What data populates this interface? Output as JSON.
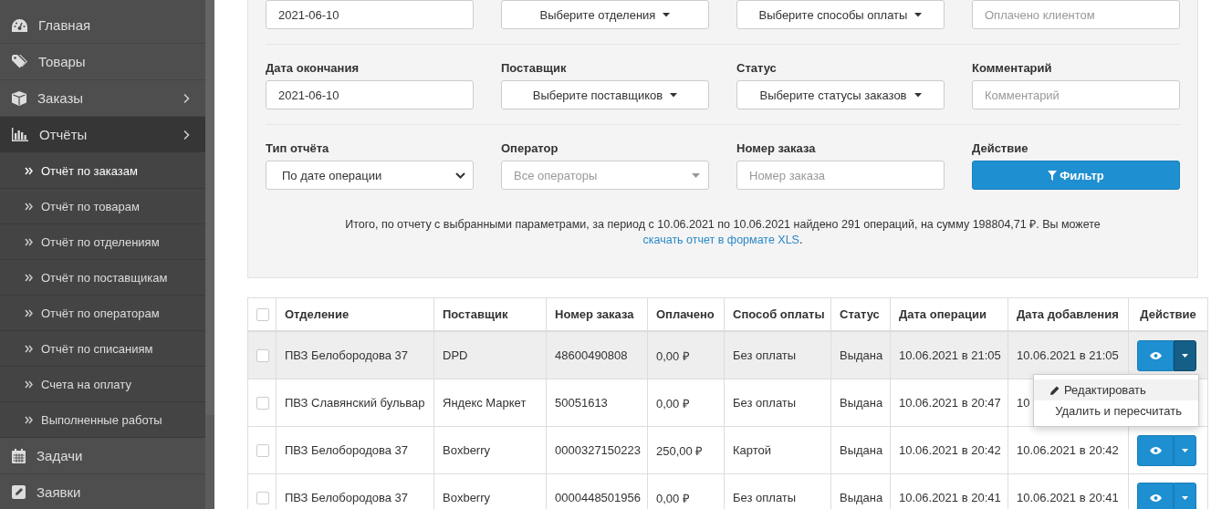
{
  "sidebar": {
    "items": [
      {
        "label": "Главная",
        "selected": false
      },
      {
        "label": "Товары",
        "selected": false
      },
      {
        "label": "Заказы",
        "selected": false,
        "expandable": true
      },
      {
        "label": "Отчёты",
        "selected": true,
        "expandable": true,
        "expanded": true,
        "children": [
          {
            "label": "Отчёт по заказам",
            "selected": true
          },
          {
            "label": "Отчёт по товарам",
            "selected": false
          },
          {
            "label": "Отчёт по отделениям",
            "selected": false
          },
          {
            "label": "Отчёт по поставщикам",
            "selected": false
          },
          {
            "label": "Отчёт по операторам",
            "selected": false
          },
          {
            "label": "Отчёт по списаниям",
            "selected": false
          },
          {
            "label": "Счета на оплату",
            "selected": false
          },
          {
            "label": "Выполненные работы",
            "selected": false
          }
        ]
      },
      {
        "label": "Задачи",
        "selected": false
      },
      {
        "label": "Заявки",
        "selected": false
      }
    ]
  },
  "filters": {
    "rows": [
      [
        {
          "kind": "input",
          "value": "2021-06-10"
        },
        {
          "kind": "dropdown",
          "text": "Выберите отделения"
        },
        {
          "kind": "dropdown",
          "text": "Выберите способы оплаты"
        },
        {
          "kind": "input",
          "placeholder": "Оплачено клиентом"
        }
      ],
      [
        {
          "label": "Дата окончания",
          "kind": "input",
          "value": "2021-06-10"
        },
        {
          "label": "Поставщик",
          "kind": "dropdown",
          "text": "Выберите поставщиков"
        },
        {
          "label": "Статус",
          "kind": "dropdown",
          "text": "Выберите статусы заказов"
        },
        {
          "label": "Комментарий",
          "kind": "input",
          "placeholder": "Комментарий"
        }
      ],
      [
        {
          "label": "Тип отчёта",
          "kind": "select",
          "text": "По дате операции"
        },
        {
          "label": "Оператор",
          "kind": "combo",
          "placeholder": "Все операторы"
        },
        {
          "label": "Номер заказа",
          "kind": "input",
          "placeholder": "Номер заказа"
        },
        {
          "label": "Действие",
          "kind": "button",
          "text": "Фильтр"
        }
      ]
    ],
    "summary": "Итого, по отчету с выбранными параметрами, за период с 10.06.2021 по 10.06.2021 найдено 291 операций, на сумму 198804,71 ₽. Вы можете ",
    "summary_link": "скачать отчет в формате XLS",
    "summary_end": "."
  },
  "table": {
    "all_checked": false,
    "columns": [
      "Отделение",
      "Поставщик",
      "Номер заказа",
      "Оплачено",
      "Способ оплаты",
      "Статус",
      "Дата операции",
      "Дата добавления",
      "Действие"
    ],
    "rows": [
      {
        "cells": [
          "ПВЗ Белобородова 37",
          "DPD",
          "48600490808",
          "0,00 ₽",
          "Без оплаты",
          "Выдана",
          "10.06.2021 в 21:05",
          "10.06.2021 в 21:05"
        ],
        "checked": false,
        "highlighted": true,
        "actions": true,
        "menu_open": true
      },
      {
        "cells": [
          "ПВЗ Славянский бульвар",
          "Яндекс Маркет",
          "50051613",
          "0,00 ₽",
          "Без оплаты",
          "Выдана",
          "10.06.2021 в 20:47",
          "10"
        ],
        "checked": false,
        "highlighted": false,
        "actions": false,
        "menu_open": false
      },
      {
        "cells": [
          "ПВЗ Белобородова 37",
          "Boxberry",
          "0000327150223",
          "250,00 ₽",
          "Картой",
          "Выдана",
          "10.06.2021 в 20:42",
          "10.06.2021 в 20:42"
        ],
        "checked": false,
        "highlighted": false,
        "actions": true,
        "menu_open": false
      },
      {
        "cells": [
          "ПВЗ Белобородова 37",
          "Boxberry",
          "0000448501956",
          "0,00 ₽",
          "Без оплаты",
          "Выдана",
          "10.06.2021 в 20:41",
          "10.06.2021 в 20:41"
        ],
        "checked": false,
        "highlighted": false,
        "actions": true,
        "menu_open": false
      }
    ],
    "menu": [
      {
        "label": "Редактировать",
        "selected": true
      },
      {
        "label": "Удалить и пересчитать",
        "selected": false
      }
    ]
  }
}
